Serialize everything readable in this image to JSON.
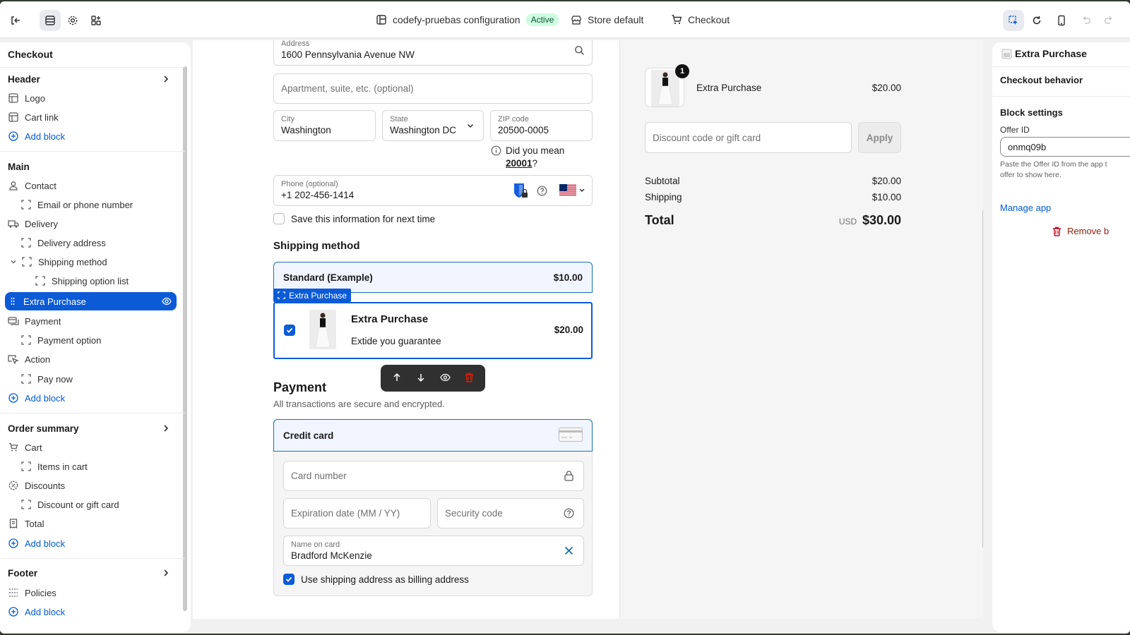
{
  "topbar": {
    "config_name": "codefy-pruebas configuration",
    "status": "Active",
    "store_label": "Store default",
    "page_label": "Checkout"
  },
  "sidebar": {
    "title": "Checkout",
    "header": {
      "label": "Header",
      "items": [
        "Logo",
        "Cart link"
      ],
      "add_block": "Add block"
    },
    "main": {
      "label": "Main",
      "contact": "Contact",
      "email": "Email or phone number",
      "delivery": "Delivery",
      "delivery_address": "Delivery address",
      "shipping_method": "Shipping method",
      "shipping_option_list": "Shipping option list",
      "extra_purchase": "Extra Purchase",
      "payment": "Payment",
      "payment_option": "Payment option",
      "action": "Action",
      "pay_now": "Pay now",
      "add_block": "Add block"
    },
    "order_summary": {
      "label": "Order summary",
      "cart": "Cart",
      "items_in_cart": "Items in cart",
      "discounts": "Discounts",
      "discount_or_gift": "Discount or gift card",
      "total": "Total",
      "add_block": "Add block"
    },
    "footer": {
      "label": "Footer",
      "policies": "Policies",
      "add_block": "Add block"
    }
  },
  "form": {
    "address_label": "Address",
    "address_value": "1600 Pennsylvania Avenue NW",
    "apartment_placeholder": "Apartment, suite, etc. (optional)",
    "city_label": "City",
    "city_value": "Washington",
    "state_label": "State",
    "state_value": "Washington DC",
    "zip_label": "ZIP code",
    "zip_value": "20500-0005",
    "did_you_mean": "Did you mean",
    "suggested_zip": "20001",
    "question_mark": "?",
    "phone_label": "Phone (optional)",
    "phone_value": "+1 202-456-1414",
    "save_info": "Save this information for next time"
  },
  "shipping": {
    "heading": "Shipping method",
    "option_name": "Standard (Example)",
    "option_price": "$10.00"
  },
  "extra_purchase": {
    "tag": "Extra Purchase",
    "title": "Extra Purchase",
    "subtitle": "Extide you guarantee",
    "price": "$20.00",
    "checked": true
  },
  "payment": {
    "heading": "Payment",
    "subheading": "All transactions are secure and encrypted.",
    "method": "Credit card",
    "card_number_placeholder": "Card number",
    "expiry_placeholder": "Expiration date (MM / YY)",
    "security_placeholder": "Security code",
    "name_label": "Name on card",
    "name_value": "Bradford McKenzie",
    "billing_same": "Use shipping address as billing address"
  },
  "summary": {
    "item_name": "Extra Purchase",
    "item_price": "$20.00",
    "item_qty": "1",
    "discount_placeholder": "Discount code or gift card",
    "apply_label": "Apply",
    "subtotal_label": "Subtotal",
    "subtotal_value": "$20.00",
    "shipping_label": "Shipping",
    "shipping_value": "$10.00",
    "total_label": "Total",
    "currency": "USD",
    "total_value": "$30.00"
  },
  "settings": {
    "title": "Extra Purchase",
    "checkout_behavior": "Checkout behavior",
    "block_settings": "Block settings",
    "offer_id_label": "Offer ID",
    "offer_id_value": "onmq09b",
    "help_text_1": "Paste the Offer ID from the app t",
    "help_text_2": "offer to show here.",
    "manage_app": "Manage app",
    "remove_block": "Remove b"
  },
  "colors": {
    "accent": "#0b5bd7",
    "link": "#005bd3",
    "danger": "#8e1f0b",
    "active_badge_bg": "#cdfee1"
  }
}
